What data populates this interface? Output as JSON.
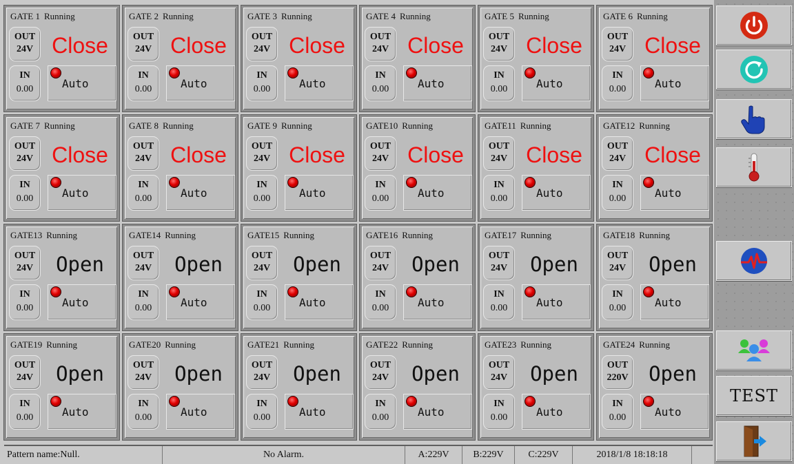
{
  "gates": [
    {
      "name": "GATE 1",
      "status": "Running",
      "out_label": "OUT",
      "out_value": "24V",
      "state": "Close",
      "in_label": "IN",
      "in_value": "0.00",
      "mode": "Auto"
    },
    {
      "name": "GATE 2",
      "status": "Running",
      "out_label": "OUT",
      "out_value": "24V",
      "state": "Close",
      "in_label": "IN",
      "in_value": "0.00",
      "mode": "Auto"
    },
    {
      "name": "GATE 3",
      "status": "Running",
      "out_label": "OUT",
      "out_value": "24V",
      "state": "Close",
      "in_label": "IN",
      "in_value": "0.00",
      "mode": "Auto"
    },
    {
      "name": "GATE 4",
      "status": "Running",
      "out_label": "OUT",
      "out_value": "24V",
      "state": "Close",
      "in_label": "IN",
      "in_value": "0.00",
      "mode": "Auto"
    },
    {
      "name": "GATE 5",
      "status": "Running",
      "out_label": "OUT",
      "out_value": "24V",
      "state": "Close",
      "in_label": "IN",
      "in_value": "0.00",
      "mode": "Auto"
    },
    {
      "name": "GATE 6",
      "status": "Running",
      "out_label": "OUT",
      "out_value": "24V",
      "state": "Close",
      "in_label": "IN",
      "in_value": "0.00",
      "mode": "Auto"
    },
    {
      "name": "GATE 7",
      "status": "Running",
      "out_label": "OUT",
      "out_value": "24V",
      "state": "Close",
      "in_label": "IN",
      "in_value": "0.00",
      "mode": "Auto"
    },
    {
      "name": "GATE 8",
      "status": "Running",
      "out_label": "OUT",
      "out_value": "24V",
      "state": "Close",
      "in_label": "IN",
      "in_value": "0.00",
      "mode": "Auto"
    },
    {
      "name": "GATE 9",
      "status": "Running",
      "out_label": "OUT",
      "out_value": "24V",
      "state": "Close",
      "in_label": "IN",
      "in_value": "0.00",
      "mode": "Auto"
    },
    {
      "name": "GATE10",
      "status": "Running",
      "out_label": "OUT",
      "out_value": "24V",
      "state": "Close",
      "in_label": "IN",
      "in_value": "0.00",
      "mode": "Auto"
    },
    {
      "name": "GATE11",
      "status": "Running",
      "out_label": "OUT",
      "out_value": "24V",
      "state": "Close",
      "in_label": "IN",
      "in_value": "0.00",
      "mode": "Auto"
    },
    {
      "name": "GATE12",
      "status": "Running",
      "out_label": "OUT",
      "out_value": "24V",
      "state": "Close",
      "in_label": "IN",
      "in_value": "0.00",
      "mode": "Auto"
    },
    {
      "name": "GATE13",
      "status": "Running",
      "out_label": "OUT",
      "out_value": "24V",
      "state": "Open",
      "in_label": "IN",
      "in_value": "0.00",
      "mode": "Auto"
    },
    {
      "name": "GATE14",
      "status": "Running",
      "out_label": "OUT",
      "out_value": "24V",
      "state": "Open",
      "in_label": "IN",
      "in_value": "0.00",
      "mode": "Auto"
    },
    {
      "name": "GATE15",
      "status": "Running",
      "out_label": "OUT",
      "out_value": "24V",
      "state": "Open",
      "in_label": "IN",
      "in_value": "0.00",
      "mode": "Auto"
    },
    {
      "name": "GATE16",
      "status": "Running",
      "out_label": "OUT",
      "out_value": "24V",
      "state": "Open",
      "in_label": "IN",
      "in_value": "0.00",
      "mode": "Auto"
    },
    {
      "name": "GATE17",
      "status": "Running",
      "out_label": "OUT",
      "out_value": "24V",
      "state": "Open",
      "in_label": "IN",
      "in_value": "0.00",
      "mode": "Auto"
    },
    {
      "name": "GATE18",
      "status": "Running",
      "out_label": "OUT",
      "out_value": "24V",
      "state": "Open",
      "in_label": "IN",
      "in_value": "0.00",
      "mode": "Auto"
    },
    {
      "name": "GATE19",
      "status": "Running",
      "out_label": "OUT",
      "out_value": "24V",
      "state": "Open",
      "in_label": "IN",
      "in_value": "0.00",
      "mode": "Auto"
    },
    {
      "name": "GATE20",
      "status": "Running",
      "out_label": "OUT",
      "out_value": "24V",
      "state": "Open",
      "in_label": "IN",
      "in_value": "0.00",
      "mode": "Auto"
    },
    {
      "name": "GATE21",
      "status": "Running",
      "out_label": "OUT",
      "out_value": "24V",
      "state": "Open",
      "in_label": "IN",
      "in_value": "0.00",
      "mode": "Auto"
    },
    {
      "name": "GATE22",
      "status": "Running",
      "out_label": "OUT",
      "out_value": "24V",
      "state": "Open",
      "in_label": "IN",
      "in_value": "0.00",
      "mode": "Auto"
    },
    {
      "name": "GATE23",
      "status": "Running",
      "out_label": "OUT",
      "out_value": "24V",
      "state": "Open",
      "in_label": "IN",
      "in_value": "0.00",
      "mode": "Auto"
    },
    {
      "name": "GATE24",
      "status": "Running",
      "out_label": "OUT",
      "out_value": "220V",
      "state": "Open",
      "in_label": "IN",
      "in_value": "0.00",
      "mode": "Auto"
    }
  ],
  "status_bar": {
    "pattern": "Pattern name:Null.",
    "alarm": "No Alarm.",
    "phase_a": "A:229V",
    "phase_b": "B:229V",
    "phase_c": "C:229V",
    "datetime": "2018/1/8 18:18:18"
  },
  "sidebar": {
    "buttons": [
      {
        "icon": "power-icon"
      },
      {
        "icon": "refresh-icon"
      },
      {
        "icon": "hand-pointer-icon"
      },
      {
        "icon": "thermometer-icon"
      },
      {
        "icon": "heartbeat-icon"
      },
      {
        "icon": "users-icon"
      },
      {
        "label": "TEST"
      },
      {
        "icon": "exit-door-icon"
      }
    ]
  },
  "colors": {
    "close_state": "#ee1111",
    "led": "#e00000",
    "power": "#d42a12",
    "refresh": "#22c4b4",
    "hand": "#1f43b5"
  }
}
